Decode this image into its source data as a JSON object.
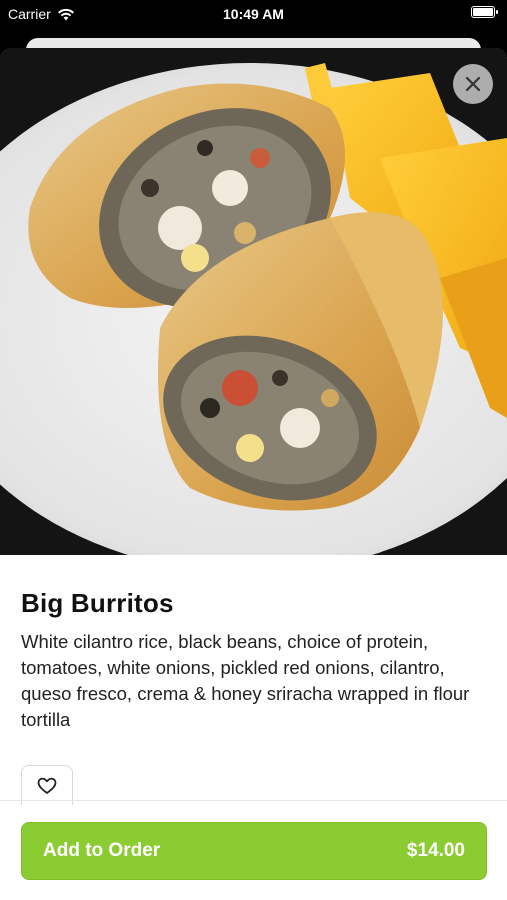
{
  "status_bar": {
    "carrier": "Carrier",
    "time": "10:49 AM"
  },
  "item": {
    "title": "Big Burritos",
    "description": "White cilantro rice, black beans, choice of protein, tomatoes, white onions, pickled red onions, cilantro, queso fresco, crema & honey sriracha wrapped in flour tortilla"
  },
  "actions": {
    "add_label": "Add to Order",
    "price": "$14.00"
  },
  "colors": {
    "accent": "#8ccc33"
  }
}
